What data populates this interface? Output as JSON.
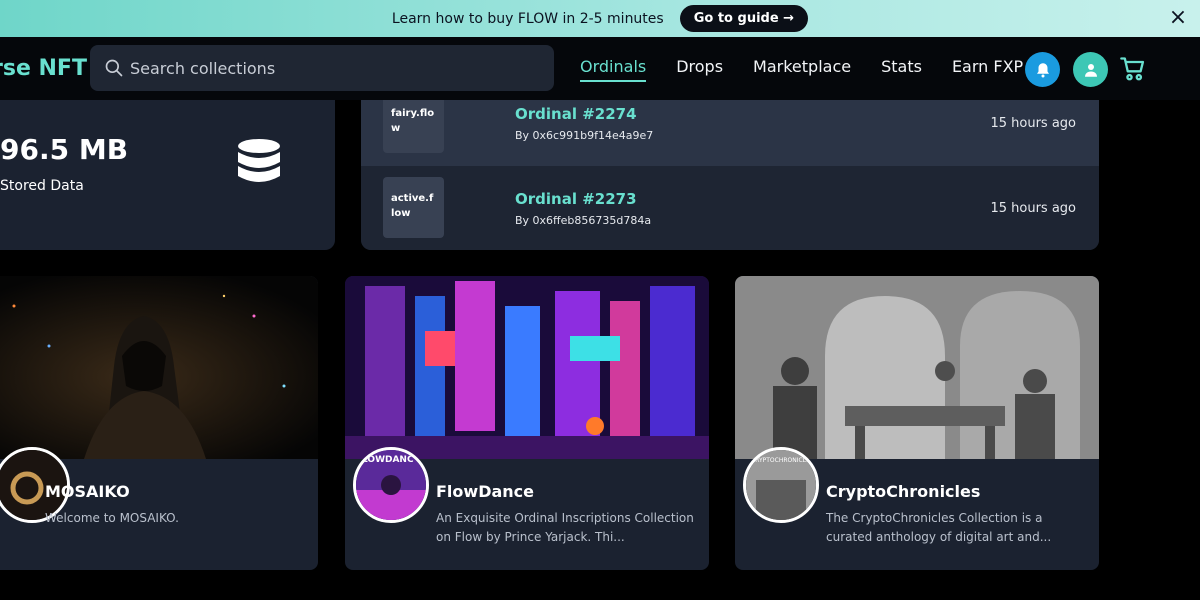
{
  "banner": {
    "text": "Learn how to buy FLOW in 2-5 minutes",
    "button_label": "Go to guide →",
    "close_icon": "×"
  },
  "nav": {
    "logo": "rse NFT",
    "search_placeholder": "Search collections",
    "links": [
      {
        "label": "Ordinals",
        "active": true
      },
      {
        "label": "Drops"
      },
      {
        "label": "Marketplace"
      },
      {
        "label": "Stats"
      },
      {
        "label": "Earn FXP"
      }
    ],
    "icons": [
      "bell-icon",
      "user-icon",
      "cart-icon"
    ]
  },
  "stat": {
    "value": "96.5 MB",
    "label": "Stored Data",
    "icon": "database-icon"
  },
  "activity": [
    {
      "thumb": "fairy.flow",
      "title": "Ordinal #2274",
      "by": "By 0x6c991b9f14e4a9e7",
      "time": "15 hours ago"
    },
    {
      "thumb": "active.flow",
      "title": "Ordinal #2273",
      "by": "By 0x6ffeb856735d784a",
      "time": "15 hours ago"
    }
  ],
  "collections": [
    {
      "name": "MOSAIKO",
      "description": "Welcome to MOSAIKO."
    },
    {
      "name": "FlowDance",
      "description": "An Exquisite Ordinal Inscriptions Collection on Flow by Prince Yarjack. Thi...",
      "avatar_text": "LOWDANC"
    },
    {
      "name": "CryptoChronicles",
      "description": "The CryptoChronicles Collection is a curated anthology of digital art and...",
      "avatar_text": "CRYPTOCHRONICLES"
    }
  ],
  "colors": {
    "accent": "#69e0cf",
    "bell": "#1a9be0",
    "user": "#3dc7b5",
    "card": "#1b2230",
    "background": "#000000"
  }
}
